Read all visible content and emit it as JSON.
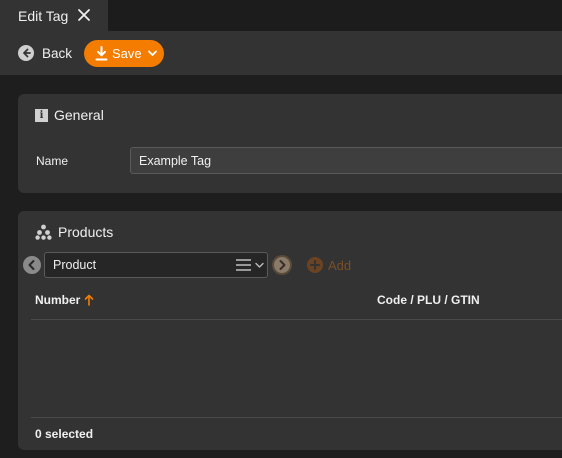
{
  "tab": {
    "label": "Edit Tag"
  },
  "toolbar": {
    "back_label": "Back",
    "save_label": "Save"
  },
  "general": {
    "title": "General",
    "name_label": "Name",
    "name_value": "Example Tag"
  },
  "products": {
    "title": "Products",
    "selector_value": "Product",
    "add_label": "Add",
    "columns": [
      "Number",
      "Code / PLU / GTIN"
    ],
    "rows": [],
    "selected_text": "0 selected"
  },
  "colors": {
    "accent": "#f47c00",
    "panel": "#333333",
    "background": "#1e1e1e",
    "text": "#e6e6e6"
  },
  "icons": [
    "close-icon",
    "back-arrow-icon",
    "download-icon",
    "chevron-down-icon",
    "info-icon",
    "products-icon",
    "chevron-left-icon",
    "menu-icon",
    "chevron-right-icon",
    "add-icon",
    "sort-up-icon"
  ]
}
